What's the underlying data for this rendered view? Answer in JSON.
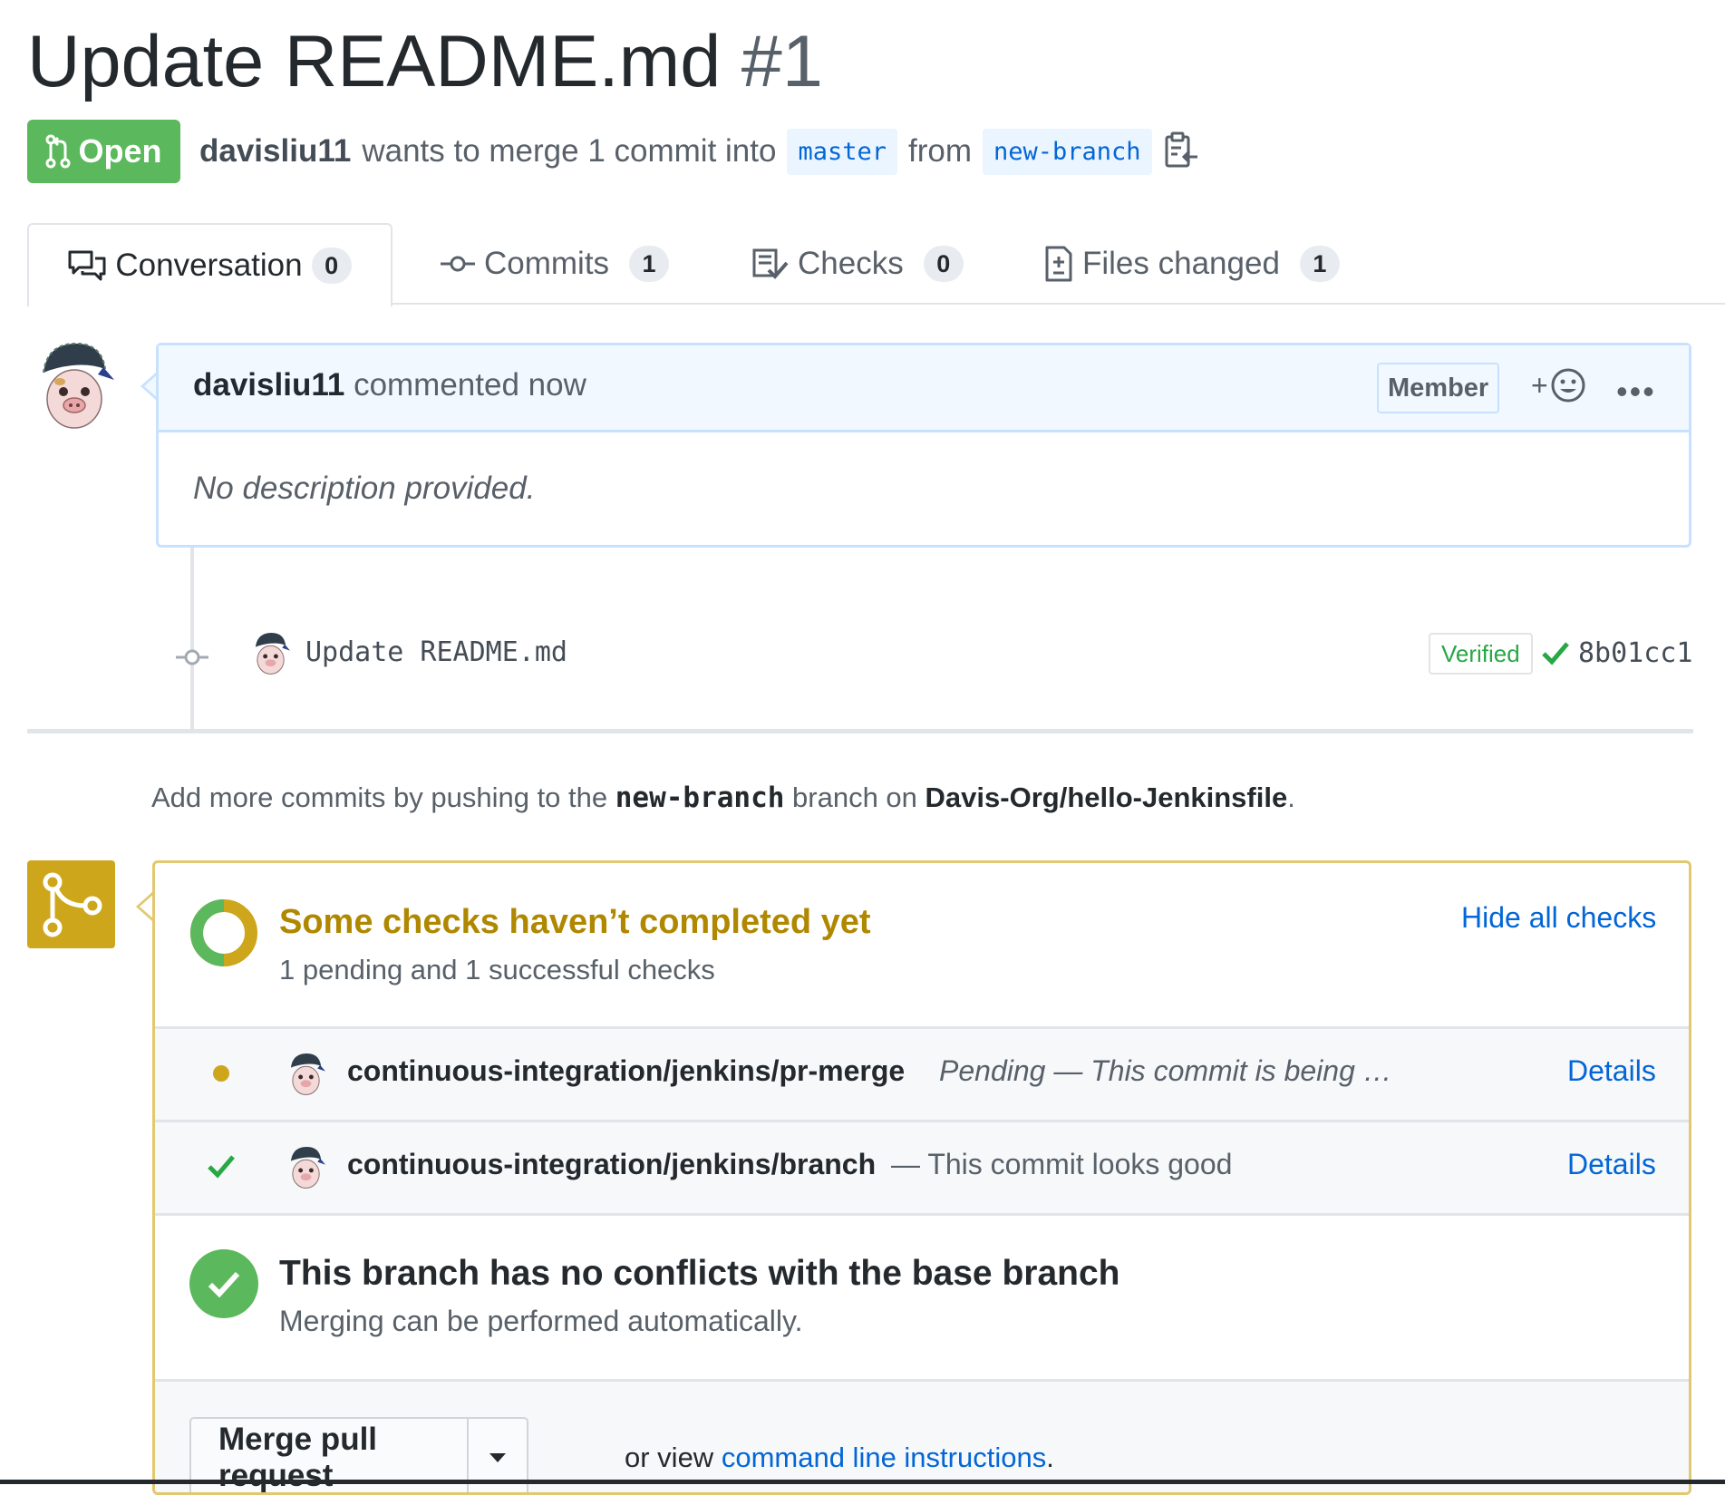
{
  "pr": {
    "title": "Update README.md",
    "number": "#1",
    "state": "Open",
    "author": "davisliu11",
    "merge_text": "wants to merge 1 commit into",
    "base_branch": "master",
    "from_text": "from",
    "head_branch": "new-branch"
  },
  "tabs": [
    {
      "label": "Conversation",
      "count": "0",
      "icon": "comment-discussion-icon"
    },
    {
      "label": "Commits",
      "count": "1",
      "icon": "git-commit-icon"
    },
    {
      "label": "Checks",
      "count": "0",
      "icon": "checklist-icon"
    },
    {
      "label": "Files changed",
      "count": "1",
      "icon": "file-diff-icon"
    }
  ],
  "comment": {
    "author": "davisliu11",
    "action": "commented now",
    "badge": "Member",
    "reaction_plus": "+",
    "more": "•••",
    "body": "No description provided."
  },
  "commit": {
    "message": "Update README.md",
    "verified": "Verified",
    "sha": "8b01cc1"
  },
  "push_note": {
    "prefix": "Add more commits by pushing to the",
    "branch": "new-branch",
    "middle": "branch on",
    "repo": "Davis-Org/hello-Jenkinsfile",
    "suffix": "."
  },
  "checks": {
    "title": "Some checks haven’t completed yet",
    "subtitle": "1 pending and 1 successful checks",
    "hide_link": "Hide all checks",
    "items": [
      {
        "name": "continuous-integration/jenkins/pr-merge",
        "description": "Pending — This commit is being …",
        "status": "pending",
        "details": "Details"
      },
      {
        "name": "continuous-integration/jenkins/branch",
        "description": "— This commit looks good",
        "status": "success",
        "details": "Details"
      }
    ]
  },
  "mergeability": {
    "title": "This branch has no conflicts with the base branch",
    "subtitle": "Merging can be performed automatically."
  },
  "merge": {
    "button_label": "Merge pull request",
    "or_view": "or view",
    "cli_link": "command line instructions",
    "period": "."
  },
  "colors": {
    "open_green": "#5cb85c",
    "pending_yellow": "#cea61b",
    "success_green": "#28a745",
    "link_blue": "#0366d6"
  }
}
